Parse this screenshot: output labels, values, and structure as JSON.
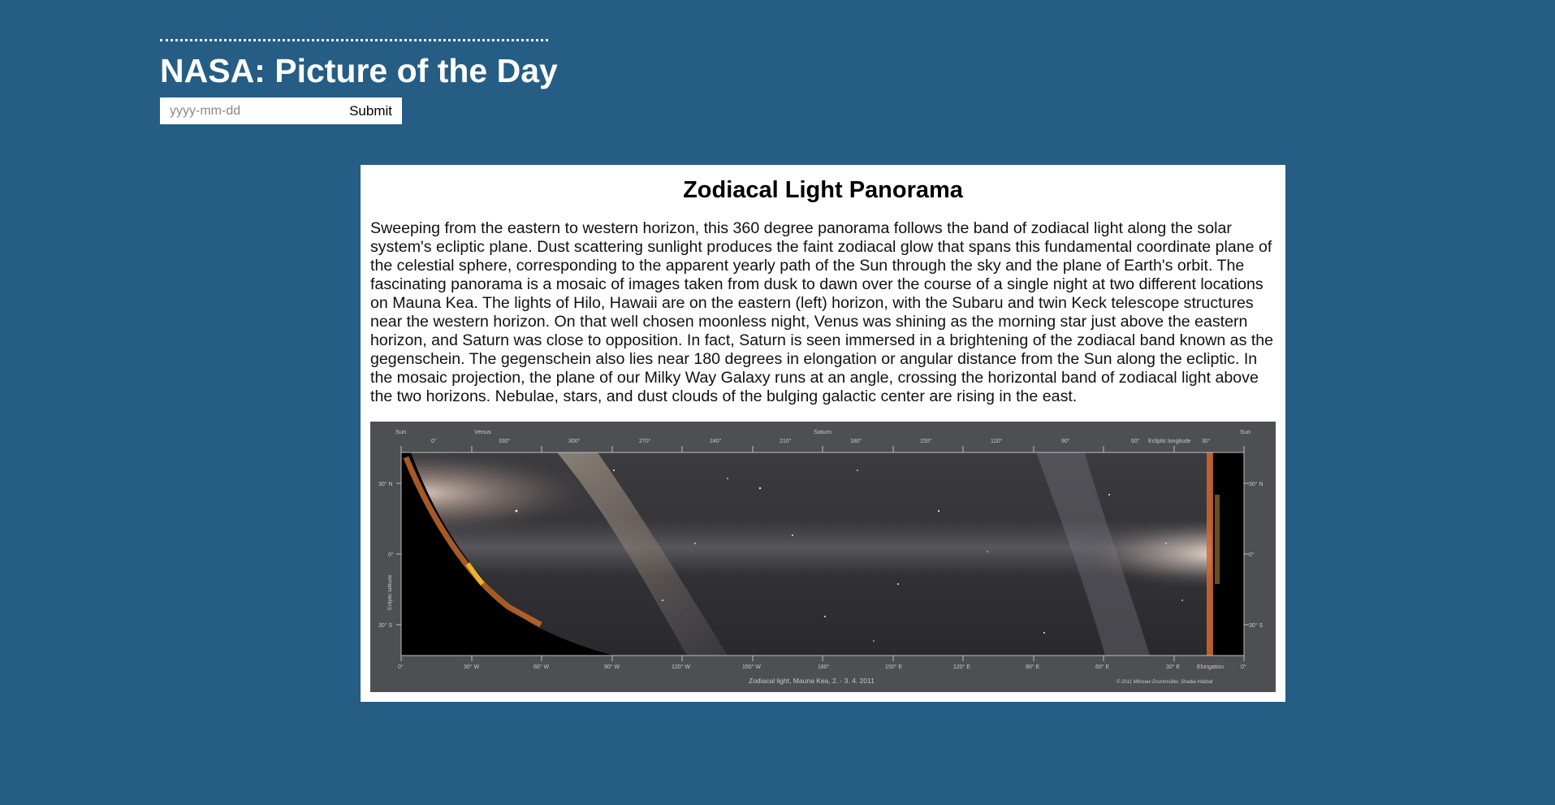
{
  "page": {
    "title": "NASA: Picture of the Day"
  },
  "search": {
    "placeholder": "yyyy-mm-dd",
    "submit_label": "Submit"
  },
  "apod": {
    "title": "Zodiacal Light Panorama",
    "explanation": "Sweeping from the eastern to western horizon, this 360 degree panorama follows the band of zodiacal light along the solar system's ecliptic plane. Dust scattering sunlight produces the faint zodiacal glow that spans this fundamental coordinate plane of the celestial sphere, corresponding to the apparent yearly path of the Sun through the sky and the plane of Earth's orbit. The fascinating panorama is a mosaic of images taken from dusk to dawn over the course of a single night at two different locations on Mauna Kea. The lights of Hilo, Hawaii are on the eastern (left) horizon, with the Subaru and twin Keck telescope structures near the western horizon. On that well chosen moonless night, Venus was shining as the morning star just above the eastern horizon, and Saturn was close to opposition. In fact, Saturn is seen immersed in a brightening of the zodiacal band known as the gegenschein. The gegenschein also lies near 180 degrees in elongation or angular distance from the Sun along the ecliptic. In the mosaic projection, the plane of our Milky Way Galaxy runs at an angle, crossing the horizontal band of zodiacal light above the two horizons. Nebulae, stars, and dust clouds of the bulging galactic center are rising in the east."
  },
  "image_labels": {
    "top_markers": [
      "Sun",
      "Venus",
      "Saturn",
      "Sun"
    ],
    "ecliptic_longitude_title": "Ecliptic longitude",
    "top_ticks": [
      "0°",
      "330°",
      "300°",
      "270°",
      "240°",
      "210°",
      "180°",
      "150°",
      "120°",
      "90°",
      "60°",
      "30°"
    ],
    "left_ticks": [
      "30° N",
      "0°",
      "30° S"
    ],
    "right_ticks": [
      "30° N",
      "0°",
      "30° S"
    ],
    "side_title": "Ecliptic latitude",
    "bottom_ticks": [
      "0°",
      "30° W",
      "60° W",
      "90° W",
      "120° W",
      "150° W",
      "180°",
      "150° E",
      "120° E",
      "90° E",
      "60° E",
      "30° E",
      "Elongation",
      "0°"
    ],
    "caption": "Zodiacal light, Mauna Kea, 2. - 3. 4. 2011",
    "credit": "© 2011 Miloslav Druckmüller, Shadia Habbal"
  }
}
